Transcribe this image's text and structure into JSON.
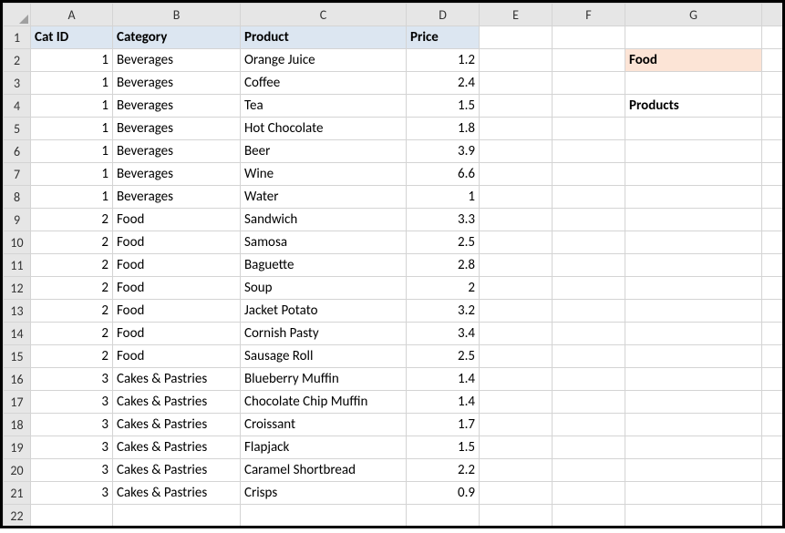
{
  "columns": [
    "A",
    "B",
    "C",
    "D",
    "E",
    "F",
    "G"
  ],
  "row_numbers": [
    1,
    2,
    3,
    4,
    5,
    6,
    7,
    8,
    9,
    10,
    11,
    12,
    13,
    14,
    15,
    16,
    17,
    18,
    19,
    20,
    21,
    22
  ],
  "headers": {
    "a": "Cat ID",
    "b": "Category",
    "c": "Product",
    "d": "Price"
  },
  "rows": [
    {
      "a": "1",
      "b": "Beverages",
      "c": "Orange Juice",
      "d": "1.2"
    },
    {
      "a": "1",
      "b": "Beverages",
      "c": "Coffee",
      "d": "2.4"
    },
    {
      "a": "1",
      "b": "Beverages",
      "c": "Tea",
      "d": "1.5"
    },
    {
      "a": "1",
      "b": "Beverages",
      "c": "Hot Chocolate",
      "d": "1.8"
    },
    {
      "a": "1",
      "b": "Beverages",
      "c": "Beer",
      "d": "3.9"
    },
    {
      "a": "1",
      "b": "Beverages",
      "c": "Wine",
      "d": "6.6"
    },
    {
      "a": "1",
      "b": "Beverages",
      "c": "Water",
      "d": "1"
    },
    {
      "a": "2",
      "b": "Food",
      "c": "Sandwich",
      "d": "3.3"
    },
    {
      "a": "2",
      "b": "Food",
      "c": "Samosa",
      "d": "2.5"
    },
    {
      "a": "2",
      "b": "Food",
      "c": "Baguette",
      "d": "2.8"
    },
    {
      "a": "2",
      "b": "Food",
      "c": "Soup",
      "d": "2"
    },
    {
      "a": "2",
      "b": "Food",
      "c": "Jacket Potato",
      "d": "3.2"
    },
    {
      "a": "2",
      "b": "Food",
      "c": "Cornish Pasty",
      "d": "3.4"
    },
    {
      "a": "2",
      "b": "Food",
      "c": "Sausage Roll",
      "d": "2.5"
    },
    {
      "a": "3",
      "b": "Cakes & Pastries",
      "c": "Blueberry Muffin",
      "d": "1.4"
    },
    {
      "a": "3",
      "b": "Cakes & Pastries",
      "c": "Chocolate Chip Muffin",
      "d": "1.4"
    },
    {
      "a": "3",
      "b": "Cakes & Pastries",
      "c": "Croissant",
      "d": "1.7"
    },
    {
      "a": "3",
      "b": "Cakes & Pastries",
      "c": "Flapjack",
      "d": "1.5"
    },
    {
      "a": "3",
      "b": "Cakes & Pastries",
      "c": "Caramel Shortbread",
      "d": "2.2"
    },
    {
      "a": "3",
      "b": "Cakes & Pastries",
      "c": "Crisps",
      "d": "0.9"
    }
  ],
  "g2": "Food",
  "g4": "Products"
}
